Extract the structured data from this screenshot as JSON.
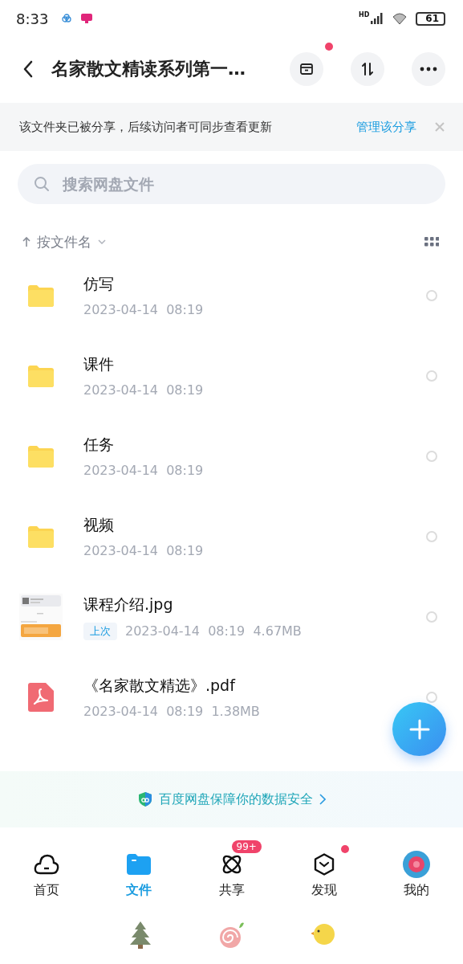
{
  "status_bar": {
    "time": "8:33",
    "network": "HD",
    "battery": "61"
  },
  "header": {
    "title": "名家散文精读系列第一…",
    "archive_dot": true
  },
  "share_notice": {
    "text": "该文件夹已被分享，后续访问者可同步查看更新",
    "link": "管理该分享"
  },
  "search": {
    "placeholder": "搜索网盘文件"
  },
  "sort": {
    "label": "按文件名"
  },
  "files": [
    {
      "kind": "folder",
      "name": "仿写",
      "meta": "2023-04-14  08:19",
      "selected": false
    },
    {
      "kind": "folder",
      "name": "课件",
      "meta": "2023-04-14  08:19",
      "selected": false
    },
    {
      "kind": "folder",
      "name": "任务",
      "meta": "2023-04-14  08:19",
      "selected": false
    },
    {
      "kind": "folder",
      "name": "视频",
      "meta": "2023-04-14  08:19",
      "selected": false
    },
    {
      "name": "课程介绍.jpg",
      "tag": "上次",
      "meta": "2023-04-14  08:19  4.67MB",
      "selected": false
    },
    {
      "kind": "pdf",
      "name": "《名家散文精选》.pdf",
      "meta": "2023-04-14  08:19  1.38MB",
      "selected": false
    }
  ],
  "security": {
    "text": "百度网盘保障你的数据安全"
  },
  "tabs": [
    {
      "kind": "home",
      "label": "首页",
      "selected": false
    },
    {
      "kind": "files",
      "label": "文件",
      "selected": true
    },
    {
      "kind": "share",
      "label": "共享",
      "selected": false,
      "badge": "99+"
    },
    {
      "kind": "discover",
      "label": "发现",
      "selected": false,
      "dot": true
    },
    {
      "kind": "me",
      "label": "我的",
      "selected": false
    }
  ]
}
